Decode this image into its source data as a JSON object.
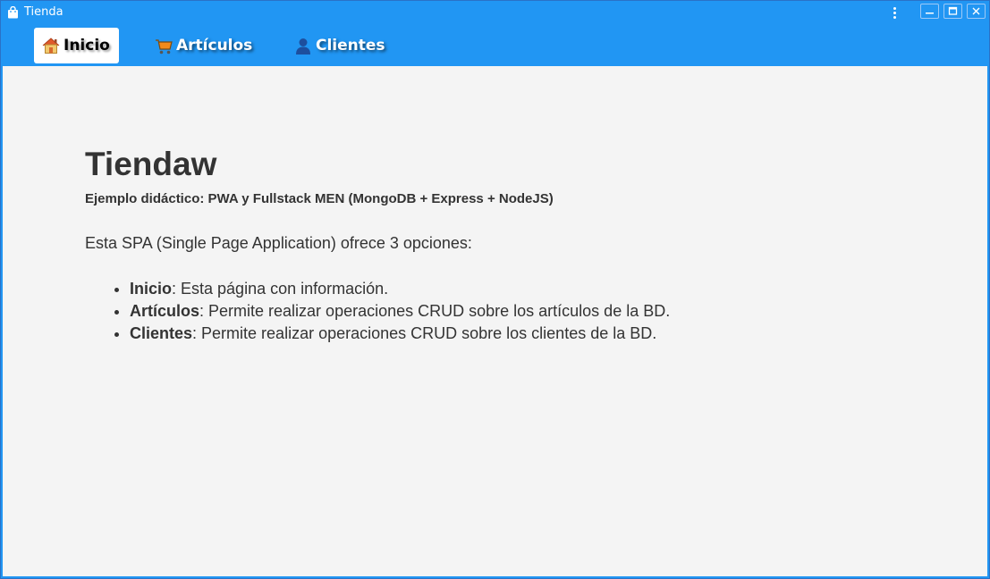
{
  "window": {
    "title": "Tienda",
    "icon": "shopping-bag-icon",
    "controls": [
      "menu-icon",
      "minimize-icon",
      "maximize-icon",
      "close-icon"
    ]
  },
  "nav": {
    "items": [
      {
        "label": "Inicio",
        "icon": "home-icon",
        "active": true
      },
      {
        "label": "Artículos",
        "icon": "cart-icon",
        "active": false
      },
      {
        "label": "Clientes",
        "icon": "user-icon",
        "active": false
      }
    ]
  },
  "content": {
    "title": "Tiendaw",
    "subtitle": "Ejemplo didáctico: PWA y Fullstack MEN (MongoDB + Express + NodeJS)",
    "intro": "Esta SPA (Single Page Application) ofrece 3 opciones:",
    "options": [
      {
        "name": "Inicio",
        "desc": ": Esta página con información."
      },
      {
        "name": "Artículos",
        "desc": ": Permite realizar operaciones CRUD sobre los artículos de la BD."
      },
      {
        "name": "Clientes",
        "desc": ": Permite realizar operaciones CRUD sobre los clientes de la BD."
      }
    ]
  },
  "colors": {
    "accent": "#2196f3",
    "background": "#f4f4f4",
    "text": "#333333"
  }
}
